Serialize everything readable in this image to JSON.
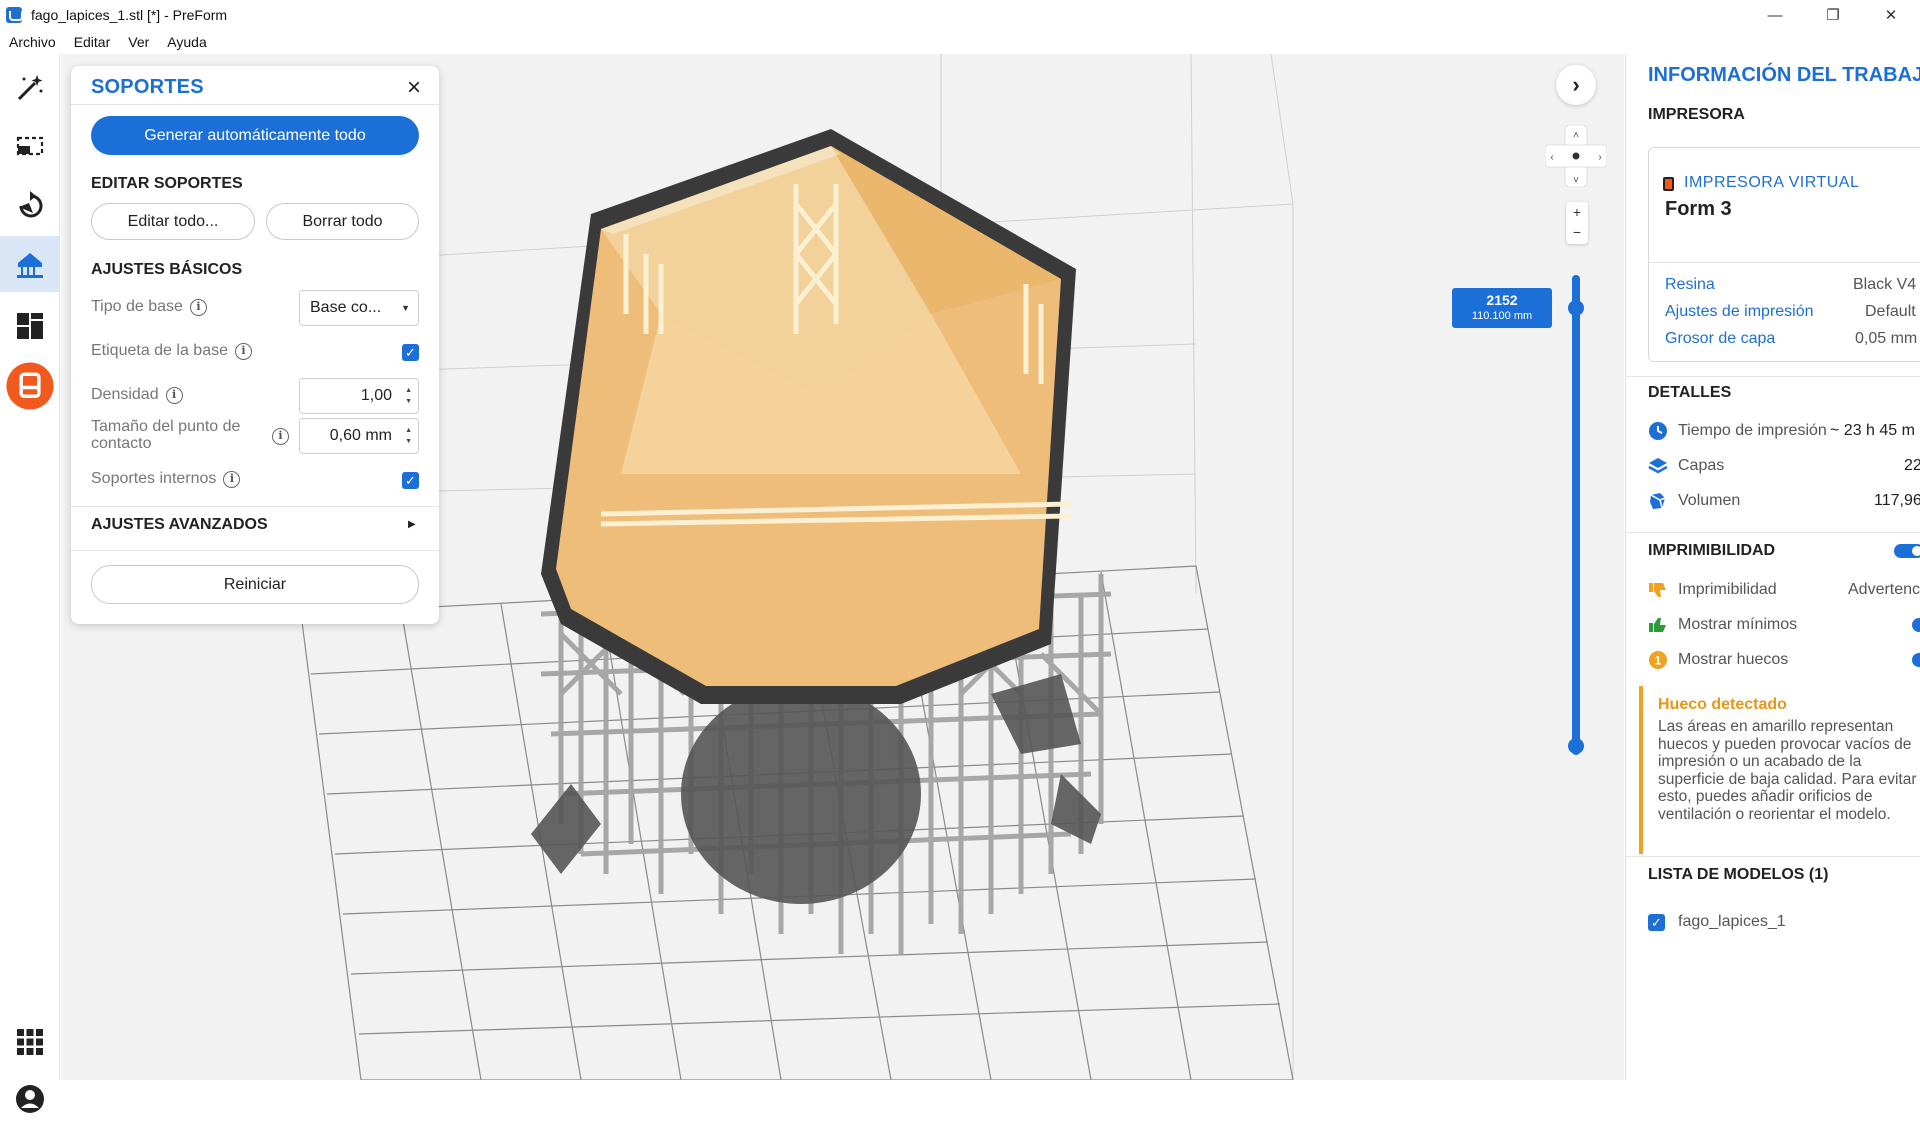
{
  "window": {
    "title": "fago_lapices_1.stl [*] - PreForm",
    "controls": [
      "—",
      "❐",
      "✕"
    ]
  },
  "menu": [
    "Archivo",
    "Editar",
    "Ver",
    "Ayuda"
  ],
  "toolbar": {
    "tools": [
      "magic-wand-icon",
      "select-box-icon",
      "orientation-icon",
      "supports-icon",
      "layout-icon",
      "print-icon"
    ],
    "bottom": [
      "apps-grid-icon",
      "account-icon"
    ],
    "active_tool": "supports-icon",
    "accent": "#f25a1d"
  },
  "supports_panel": {
    "title": "SOPORTES",
    "generate_all": "Generar automáticamente todo",
    "edit_section": "EDITAR SOPORTES",
    "edit_all": "Editar todo...",
    "delete_all": "Borrar todo",
    "basic_section": "AJUSTES BÁSICOS",
    "base_type_label": "Tipo de base",
    "base_type_value": "Base co...",
    "base_label_label": "Etiqueta de la base",
    "base_label_checked": true,
    "density_label": "Densidad",
    "density_value": "1,00",
    "touchpoint_label_1": "Tamaño del punto de",
    "touchpoint_label_2": "contacto",
    "touchpoint_value": "0,60 mm",
    "internal_label": "Soportes internos",
    "internal_checked": true,
    "advanced_section": "AJUSTES AVANZADOS",
    "reset": "Reiniciar"
  },
  "layer_slider": {
    "layer": "2152",
    "height": "110.100 mm",
    "position_fraction": 0.03
  },
  "job_info": {
    "title": "INFORMACIÓN DEL TRABAJO",
    "printer_section": "IMPRESORA",
    "printer_type": "IMPRESORA VIRTUAL",
    "printer_model": "Form 3",
    "resin_key": "Resina",
    "resin_value": "Black V4",
    "print_settings_key": "Ajustes de impresión",
    "print_settings_value": "Default",
    "layer_thickness_key": "Grosor de capa",
    "layer_thickness_value": "0,05 mm",
    "details_section": "DETALLES",
    "print_time_label": "Tiempo de impresión",
    "print_time_value": "~ 23 h 45 m",
    "layers_label": "Capas",
    "layers_value": "22",
    "volume_label": "Volumen",
    "volume_value": "117,96",
    "printability_section": "IMPRIMIBILIDAD",
    "printability_label": "Imprimibilidad",
    "printability_value": "Advertencia",
    "show_minima_label": "Mostrar mínimos",
    "show_holes_label": "Mostrar huecos",
    "warning_title": "Hueco detectado",
    "warning_text": "Las áreas en amarillo representan huecos y pueden provocar vacíos de impresión o un acabado de la superficie de baja calidad. Para evitar esto, puedes añadir orificios de ventilación o reorientar el modelo.",
    "models_section": "LISTA DE MODELOS (1)",
    "model_name": "fago_lapices_1"
  }
}
